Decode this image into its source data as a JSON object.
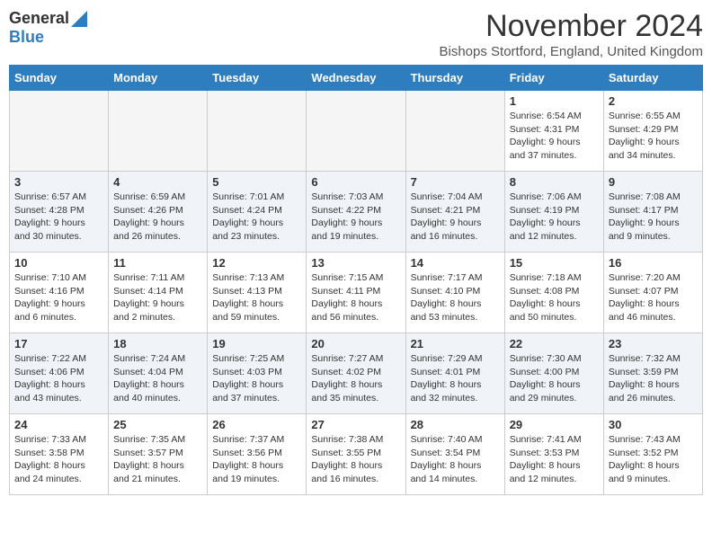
{
  "header": {
    "logo_general": "General",
    "logo_blue": "Blue",
    "title": "November 2024",
    "location": "Bishops Stortford, England, United Kingdom"
  },
  "days_of_week": [
    "Sunday",
    "Monday",
    "Tuesday",
    "Wednesday",
    "Thursday",
    "Friday",
    "Saturday"
  ],
  "weeks": [
    {
      "days": [
        {
          "num": "",
          "empty": true
        },
        {
          "num": "",
          "empty": true
        },
        {
          "num": "",
          "empty": true
        },
        {
          "num": "",
          "empty": true
        },
        {
          "num": "",
          "empty": true
        },
        {
          "num": "1",
          "sunrise": "Sunrise: 6:54 AM",
          "sunset": "Sunset: 4:31 PM",
          "daylight": "Daylight: 9 hours and 37 minutes."
        },
        {
          "num": "2",
          "sunrise": "Sunrise: 6:55 AM",
          "sunset": "Sunset: 4:29 PM",
          "daylight": "Daylight: 9 hours and 34 minutes."
        }
      ]
    },
    {
      "days": [
        {
          "num": "3",
          "sunrise": "Sunrise: 6:57 AM",
          "sunset": "Sunset: 4:28 PM",
          "daylight": "Daylight: 9 hours and 30 minutes."
        },
        {
          "num": "4",
          "sunrise": "Sunrise: 6:59 AM",
          "sunset": "Sunset: 4:26 PM",
          "daylight": "Daylight: 9 hours and 26 minutes."
        },
        {
          "num": "5",
          "sunrise": "Sunrise: 7:01 AM",
          "sunset": "Sunset: 4:24 PM",
          "daylight": "Daylight: 9 hours and 23 minutes."
        },
        {
          "num": "6",
          "sunrise": "Sunrise: 7:03 AM",
          "sunset": "Sunset: 4:22 PM",
          "daylight": "Daylight: 9 hours and 19 minutes."
        },
        {
          "num": "7",
          "sunrise": "Sunrise: 7:04 AM",
          "sunset": "Sunset: 4:21 PM",
          "daylight": "Daylight: 9 hours and 16 minutes."
        },
        {
          "num": "8",
          "sunrise": "Sunrise: 7:06 AM",
          "sunset": "Sunset: 4:19 PM",
          "daylight": "Daylight: 9 hours and 12 minutes."
        },
        {
          "num": "9",
          "sunrise": "Sunrise: 7:08 AM",
          "sunset": "Sunset: 4:17 PM",
          "daylight": "Daylight: 9 hours and 9 minutes."
        }
      ]
    },
    {
      "days": [
        {
          "num": "10",
          "sunrise": "Sunrise: 7:10 AM",
          "sunset": "Sunset: 4:16 PM",
          "daylight": "Daylight: 9 hours and 6 minutes."
        },
        {
          "num": "11",
          "sunrise": "Sunrise: 7:11 AM",
          "sunset": "Sunset: 4:14 PM",
          "daylight": "Daylight: 9 hours and 2 minutes."
        },
        {
          "num": "12",
          "sunrise": "Sunrise: 7:13 AM",
          "sunset": "Sunset: 4:13 PM",
          "daylight": "Daylight: 8 hours and 59 minutes."
        },
        {
          "num": "13",
          "sunrise": "Sunrise: 7:15 AM",
          "sunset": "Sunset: 4:11 PM",
          "daylight": "Daylight: 8 hours and 56 minutes."
        },
        {
          "num": "14",
          "sunrise": "Sunrise: 7:17 AM",
          "sunset": "Sunset: 4:10 PM",
          "daylight": "Daylight: 8 hours and 53 minutes."
        },
        {
          "num": "15",
          "sunrise": "Sunrise: 7:18 AM",
          "sunset": "Sunset: 4:08 PM",
          "daylight": "Daylight: 8 hours and 50 minutes."
        },
        {
          "num": "16",
          "sunrise": "Sunrise: 7:20 AM",
          "sunset": "Sunset: 4:07 PM",
          "daylight": "Daylight: 8 hours and 46 minutes."
        }
      ]
    },
    {
      "days": [
        {
          "num": "17",
          "sunrise": "Sunrise: 7:22 AM",
          "sunset": "Sunset: 4:06 PM",
          "daylight": "Daylight: 8 hours and 43 minutes."
        },
        {
          "num": "18",
          "sunrise": "Sunrise: 7:24 AM",
          "sunset": "Sunset: 4:04 PM",
          "daylight": "Daylight: 8 hours and 40 minutes."
        },
        {
          "num": "19",
          "sunrise": "Sunrise: 7:25 AM",
          "sunset": "Sunset: 4:03 PM",
          "daylight": "Daylight: 8 hours and 37 minutes."
        },
        {
          "num": "20",
          "sunrise": "Sunrise: 7:27 AM",
          "sunset": "Sunset: 4:02 PM",
          "daylight": "Daylight: 8 hours and 35 minutes."
        },
        {
          "num": "21",
          "sunrise": "Sunrise: 7:29 AM",
          "sunset": "Sunset: 4:01 PM",
          "daylight": "Daylight: 8 hours and 32 minutes."
        },
        {
          "num": "22",
          "sunrise": "Sunrise: 7:30 AM",
          "sunset": "Sunset: 4:00 PM",
          "daylight": "Daylight: 8 hours and 29 minutes."
        },
        {
          "num": "23",
          "sunrise": "Sunrise: 7:32 AM",
          "sunset": "Sunset: 3:59 PM",
          "daylight": "Daylight: 8 hours and 26 minutes."
        }
      ]
    },
    {
      "days": [
        {
          "num": "24",
          "sunrise": "Sunrise: 7:33 AM",
          "sunset": "Sunset: 3:58 PM",
          "daylight": "Daylight: 8 hours and 24 minutes."
        },
        {
          "num": "25",
          "sunrise": "Sunrise: 7:35 AM",
          "sunset": "Sunset: 3:57 PM",
          "daylight": "Daylight: 8 hours and 21 minutes."
        },
        {
          "num": "26",
          "sunrise": "Sunrise: 7:37 AM",
          "sunset": "Sunset: 3:56 PM",
          "daylight": "Daylight: 8 hours and 19 minutes."
        },
        {
          "num": "27",
          "sunrise": "Sunrise: 7:38 AM",
          "sunset": "Sunset: 3:55 PM",
          "daylight": "Daylight: 8 hours and 16 minutes."
        },
        {
          "num": "28",
          "sunrise": "Sunrise: 7:40 AM",
          "sunset": "Sunset: 3:54 PM",
          "daylight": "Daylight: 8 hours and 14 minutes."
        },
        {
          "num": "29",
          "sunrise": "Sunrise: 7:41 AM",
          "sunset": "Sunset: 3:53 PM",
          "daylight": "Daylight: 8 hours and 12 minutes."
        },
        {
          "num": "30",
          "sunrise": "Sunrise: 7:43 AM",
          "sunset": "Sunset: 3:52 PM",
          "daylight": "Daylight: 8 hours and 9 minutes."
        }
      ]
    }
  ]
}
